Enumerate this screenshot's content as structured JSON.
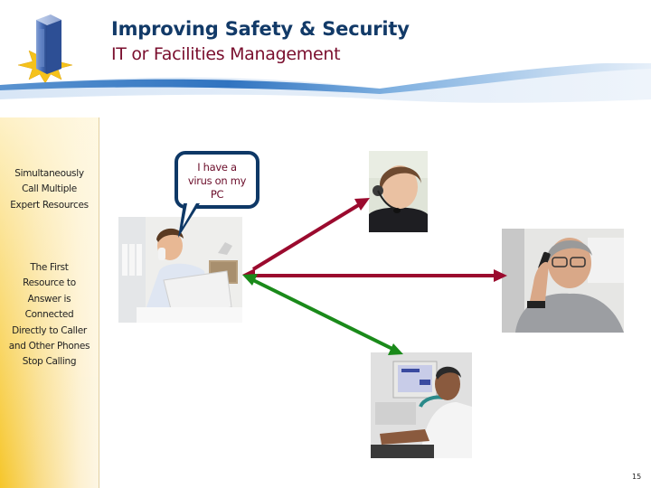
{
  "header": {
    "title": "Improving Safety & Security",
    "subtitle": "IT or Facilities Management",
    "logo_icon": "building-star-logo"
  },
  "sidebar": {
    "block1": [
      "Simultaneously",
      "Call Multiple",
      "Expert Resources"
    ],
    "block2": [
      "The First",
      "Resource to",
      "Answer is",
      "Connected",
      "Directly to Caller",
      "and Other Phones",
      "Stop Calling"
    ]
  },
  "speech_bubble": {
    "lines": [
      "I have a",
      "virus on my",
      "PC"
    ]
  },
  "photos": {
    "caller": "man-on-phone-at-laptop",
    "expert_1": "woman-with-headset",
    "expert_2": "man-with-glasses-on-cellphone",
    "expert_3": "man-at-computer-on-phone"
  },
  "arrows": {
    "red_color": "#9b0a2e",
    "green_color": "#1a8a1a",
    "blue_color": "#0e3866"
  },
  "footer": {
    "page_number": "15"
  },
  "colors": {
    "title": "#123a68",
    "subtitle": "#7a0f2e",
    "bubble_border": "#0e3866",
    "bubble_text": "#6b0d2a"
  }
}
